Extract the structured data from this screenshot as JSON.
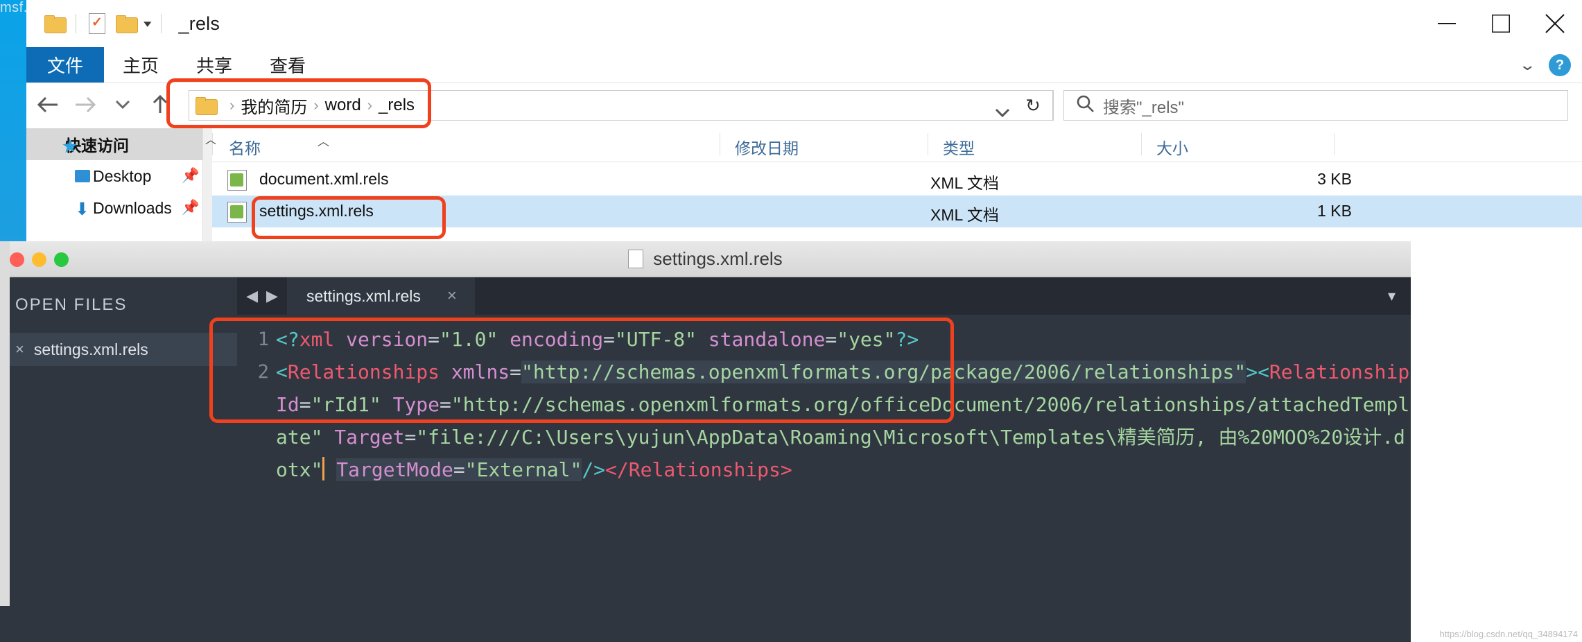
{
  "desktop": {
    "behind_label": "msf.exe"
  },
  "explorer": {
    "title": "_rels",
    "quick_access_toolbar": [
      {
        "name": "folder-icon",
        "label": ""
      },
      {
        "name": "properties-icon",
        "label": ""
      },
      {
        "name": "new-folder-icon",
        "label": ""
      },
      {
        "name": "customize-caret",
        "label": "▾"
      }
    ],
    "window_controls": {
      "minimize": "Minimize",
      "maximize": "Maximize",
      "close": "Close"
    },
    "ribbon": {
      "file_tab": "文件",
      "tabs": [
        "主页",
        "共享",
        "查看"
      ],
      "collapse_caret": "⌄",
      "help": "?"
    },
    "navigation": {
      "back": "←",
      "forward": "→",
      "recent": "⌄",
      "up": "↑"
    },
    "address": {
      "crumbs": [
        "我的简历",
        "word",
        "_rels"
      ],
      "separator": "›",
      "dropdown": "⌄",
      "refresh": "↻"
    },
    "search": {
      "placeholder": "搜索\"_rels\""
    },
    "columns": [
      {
        "key": "name",
        "label": "名称"
      },
      {
        "key": "date",
        "label": "修改日期"
      },
      {
        "key": "type",
        "label": "类型"
      },
      {
        "key": "size",
        "label": "大小"
      }
    ],
    "nav_pane": [
      {
        "label": "快速访问",
        "icon": "star-icon",
        "pinned": false,
        "header": true
      },
      {
        "label": "Desktop",
        "icon": "desktop-icon",
        "pinned": true,
        "header": false
      },
      {
        "label": "Downloads",
        "icon": "download-icon",
        "pinned": true,
        "header": false
      }
    ],
    "files": [
      {
        "name": "document.xml.rels",
        "date": "",
        "type": "XML 文档",
        "size": "3 KB",
        "selected": false
      },
      {
        "name": "settings.xml.rels",
        "date": "",
        "type": "XML 文档",
        "size": "1 KB",
        "selected": true
      }
    ]
  },
  "editor": {
    "window_title": "settings.xml.rels",
    "traffic_lights": [
      "close",
      "minimize",
      "zoom"
    ],
    "sidebar": {
      "header": "OPEN FILES",
      "items": [
        {
          "label": "settings.xml.rels",
          "close": "×"
        }
      ]
    },
    "tabs": [
      {
        "label": "settings.xml.rels",
        "close": "×",
        "active": true
      }
    ],
    "tab_nav": {
      "prev": "◀",
      "next": "▶",
      "overflow": "▾"
    },
    "gutter_lines": [
      "1",
      "2"
    ],
    "code_lines": [
      {
        "number": "1",
        "text": "<?xml version=\"1.0\" encoding=\"UTF-8\" standalone=\"yes\"?>"
      },
      {
        "number": "2",
        "text": "<Relationships xmlns=\"http://schemas.openxmlformats.org/package/2006/relationships\"><Relationship Id=\"rId1\" Type=\"http://schemas.openxmlformats.org/officeDocument/2006/relationships/attachedTemplate\" Target=\"file:///C:\\Users\\yujun\\AppData\\Roaming\\Microsoft\\Templates\\精美简历, 由%20MOO%20设计.dotx\" TargetMode=\"External\"/></Relationships>"
      }
    ],
    "code_tokens": {
      "l1": {
        "open": "<?",
        "tag": "xml",
        "a1": "version",
        "v1": "\"1.0\"",
        "a2": "encoding",
        "v2": "\"UTF-8\"",
        "a3": "standalone",
        "v3": "\"yes\"",
        "close": "?>"
      },
      "l2": {
        "open": "<",
        "tag": "Relationships",
        "a1": "xmlns",
        "v1": "\"http://schemas.openxmlformats.org/package/2006/relationships\"",
        "gt": ">",
        "open2": "<",
        "tag2": "Relationship",
        "a2": "Id",
        "v2": "\"rId1\"",
        "a3": "Type",
        "v3": "\"http://schemas.openxmlformats.org/officeDocument/2006/relationships/attachedTemplate\"",
        "a4": "Target",
        "v4": "\"file:///C:\\Users\\yujun\\AppData\\Roaming\\Microsoft\\Templates\\精美简历, 由%20MOO%20设计.dotx\"",
        "a5": "TargetMode",
        "v5": "\"External\"",
        "selfclose": "/>",
        "endtag": "</Relationships>"
      }
    }
  },
  "annotations": {
    "color": "#f0411f",
    "boxes": [
      "address-bar",
      "selected-file-row",
      "code-block"
    ]
  },
  "watermark": "https://blog.csdn.net/qq_34894174"
}
